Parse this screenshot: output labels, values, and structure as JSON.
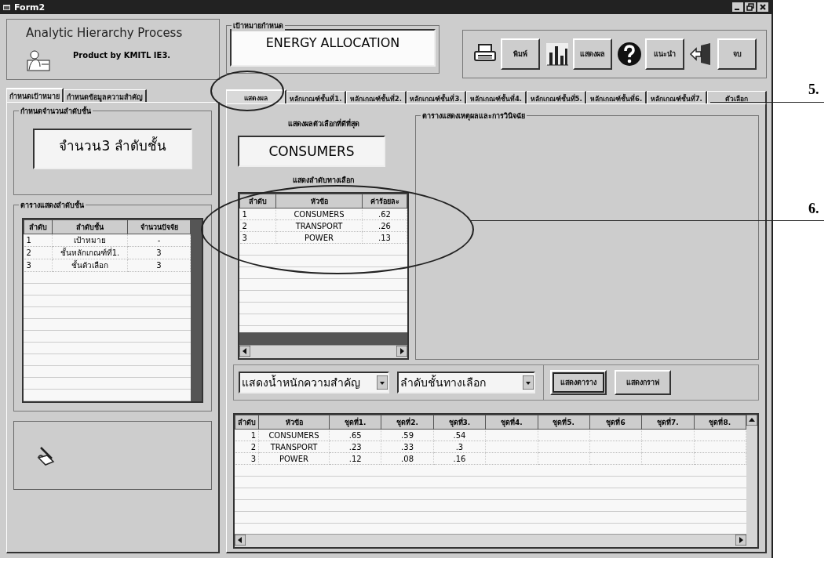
{
  "window": {
    "title": "Form2"
  },
  "app_header": {
    "title": "Analytic Hierarchy Process",
    "subtitle": "Product by KMITL IE3."
  },
  "goal": {
    "label": "เป้าหมายกำหนด",
    "value": "ENERGY ALLOCATION"
  },
  "toolbar": [
    {
      "kind": "printer",
      "label": "พิมพ์"
    },
    {
      "kind": "chart",
      "label": "แสดงผล"
    },
    {
      "kind": "help",
      "label": "แนะนำ"
    },
    {
      "kind": "exit",
      "label": "จบ"
    }
  ],
  "left_tabs": [
    {
      "label": "กำหนดเป้าหมาย",
      "selected": true
    },
    {
      "label": "กำหนดข้อมูลความสำคัญ",
      "selected": false
    }
  ],
  "levels_group": {
    "label": "กำหนดจำนวนลำดับชั้น",
    "value": "จำนวน3 ลำดับชั้น"
  },
  "levels_table": {
    "label": "ตารางแสดงลำดับชั้น",
    "columns": [
      "ลำดับ",
      "ลำดับชั้น",
      "จำนวนปัจจัย"
    ],
    "rows": [
      [
        "1",
        "เป้าหมาย",
        "-"
      ],
      [
        "2",
        "ชั้นหลักเกณฑ์ที่1.",
        "3"
      ],
      [
        "3",
        "ชั้นตัวเลือก",
        "3"
      ]
    ]
  },
  "right_tabs": [
    {
      "label": "แสดงผล",
      "selected": true
    },
    {
      "label": "หลักเกณฑ์ชั้นที่1.",
      "selected": false
    },
    {
      "label": "หลักเกณฑ์ชั้นที่2.",
      "selected": false
    },
    {
      "label": "หลักเกณฑ์ชั้นที่3.",
      "selected": false
    },
    {
      "label": "หลักเกณฑ์ชั้นที่4.",
      "selected": false
    },
    {
      "label": "หลักเกณฑ์ชั้นที่5.",
      "selected": false
    },
    {
      "label": "หลักเกณฑ์ชั้นที่6.",
      "selected": false
    },
    {
      "label": "หลักเกณฑ์ชั้นที่7.",
      "selected": false
    },
    {
      "label": "ตัวเลือก",
      "selected": false
    }
  ],
  "best": {
    "label": "แสดงผลตัวเลือกที่ดีที่สุด",
    "value": "CONSUMERS"
  },
  "ranking": {
    "label": "แสดงลำดับทางเลือก",
    "columns": [
      "ลำดับ",
      "หัวข้อ",
      "ค่าร้อยละ"
    ],
    "rows": [
      [
        "1",
        "CONSUMERS",
        ".62"
      ],
      [
        "2",
        "TRANSPORT",
        ".26"
      ],
      [
        "3",
        "POWER",
        ".13"
      ]
    ]
  },
  "reasons": {
    "label": "ตารางแสดงเหตุผลและการวินิจฉัย"
  },
  "view_controls": {
    "selects": [
      "แสดงน้ำหนักความสำคัญ",
      "ลำดับชั้นทางเลือก"
    ],
    "buttons": [
      {
        "label": "แสดงตาราง",
        "selected": true
      },
      {
        "label": "แสดงกราฟ",
        "selected": false
      }
    ]
  },
  "result_table": {
    "columns": [
      "ลำดับ",
      "หัวข้อ",
      "ชุดที่1.",
      "ชุดที่2.",
      "ชุดที่3.",
      "ชุดที่4.",
      "ชุดที่5.",
      "ชุดที่6",
      "ชุดที่7.",
      "ชุดที่8."
    ],
    "rows": [
      [
        "1",
        "CONSUMERS",
        ".65",
        ".59",
        ".54"
      ],
      [
        "2",
        "TRANSPORT",
        ".23",
        ".33",
        ".3"
      ],
      [
        "3",
        "POWER",
        ".12",
        ".08",
        ".16"
      ]
    ]
  },
  "annotations": [
    {
      "label": "5."
    },
    {
      "label": "6."
    }
  ]
}
